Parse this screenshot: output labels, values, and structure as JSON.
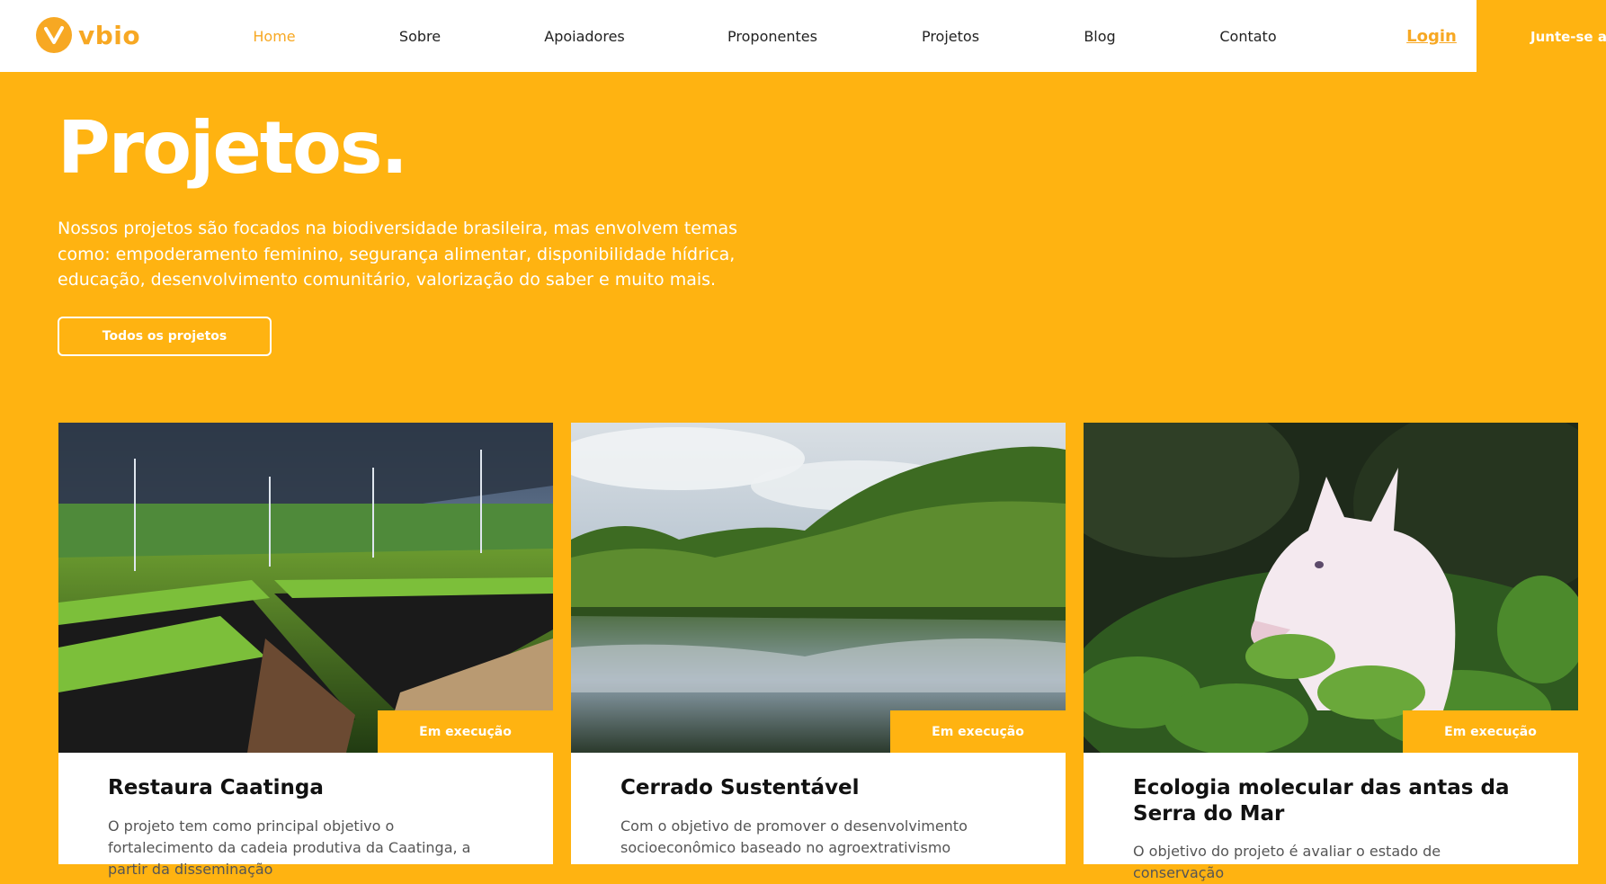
{
  "header": {
    "logo_text": "vbio",
    "nav": [
      "Home",
      "Sobre",
      "Apoiadores",
      "Proponentes",
      "Projetos",
      "Blog",
      "Contato"
    ],
    "login": "Login",
    "join": "Junte-se a n"
  },
  "hero": {
    "title": "Projetos.",
    "description": "Nossos projetos são focados na biodiversidade brasileira, mas envolvem temas como: empoderamento feminino, segurança alimentar, disponibilidade hídrica, educação, desenvolvimento comunitário, valorização do saber e muito mais.",
    "cta": "Todos os projetos"
  },
  "cards": [
    {
      "status": "Em execução",
      "title": "Restaura Caatinga",
      "description": "O projeto tem como principal objetivo o fortalecimento da cadeia produtiva da Caatinga, a partir da disseminação"
    },
    {
      "status": "Em execução",
      "title": "Cerrado Sustentável",
      "description": "Com o objetivo de promover o desenvolvimento socioeconômico baseado no agroextrativismo"
    },
    {
      "status": "Em execução",
      "title": "Ecologia molecular das antas da Serra do Mar",
      "description": "O objetivo do projeto é avaliar o estado de conservação"
    }
  ],
  "colors": {
    "brand": "#FFB311",
    "logo": "#F7A823"
  }
}
